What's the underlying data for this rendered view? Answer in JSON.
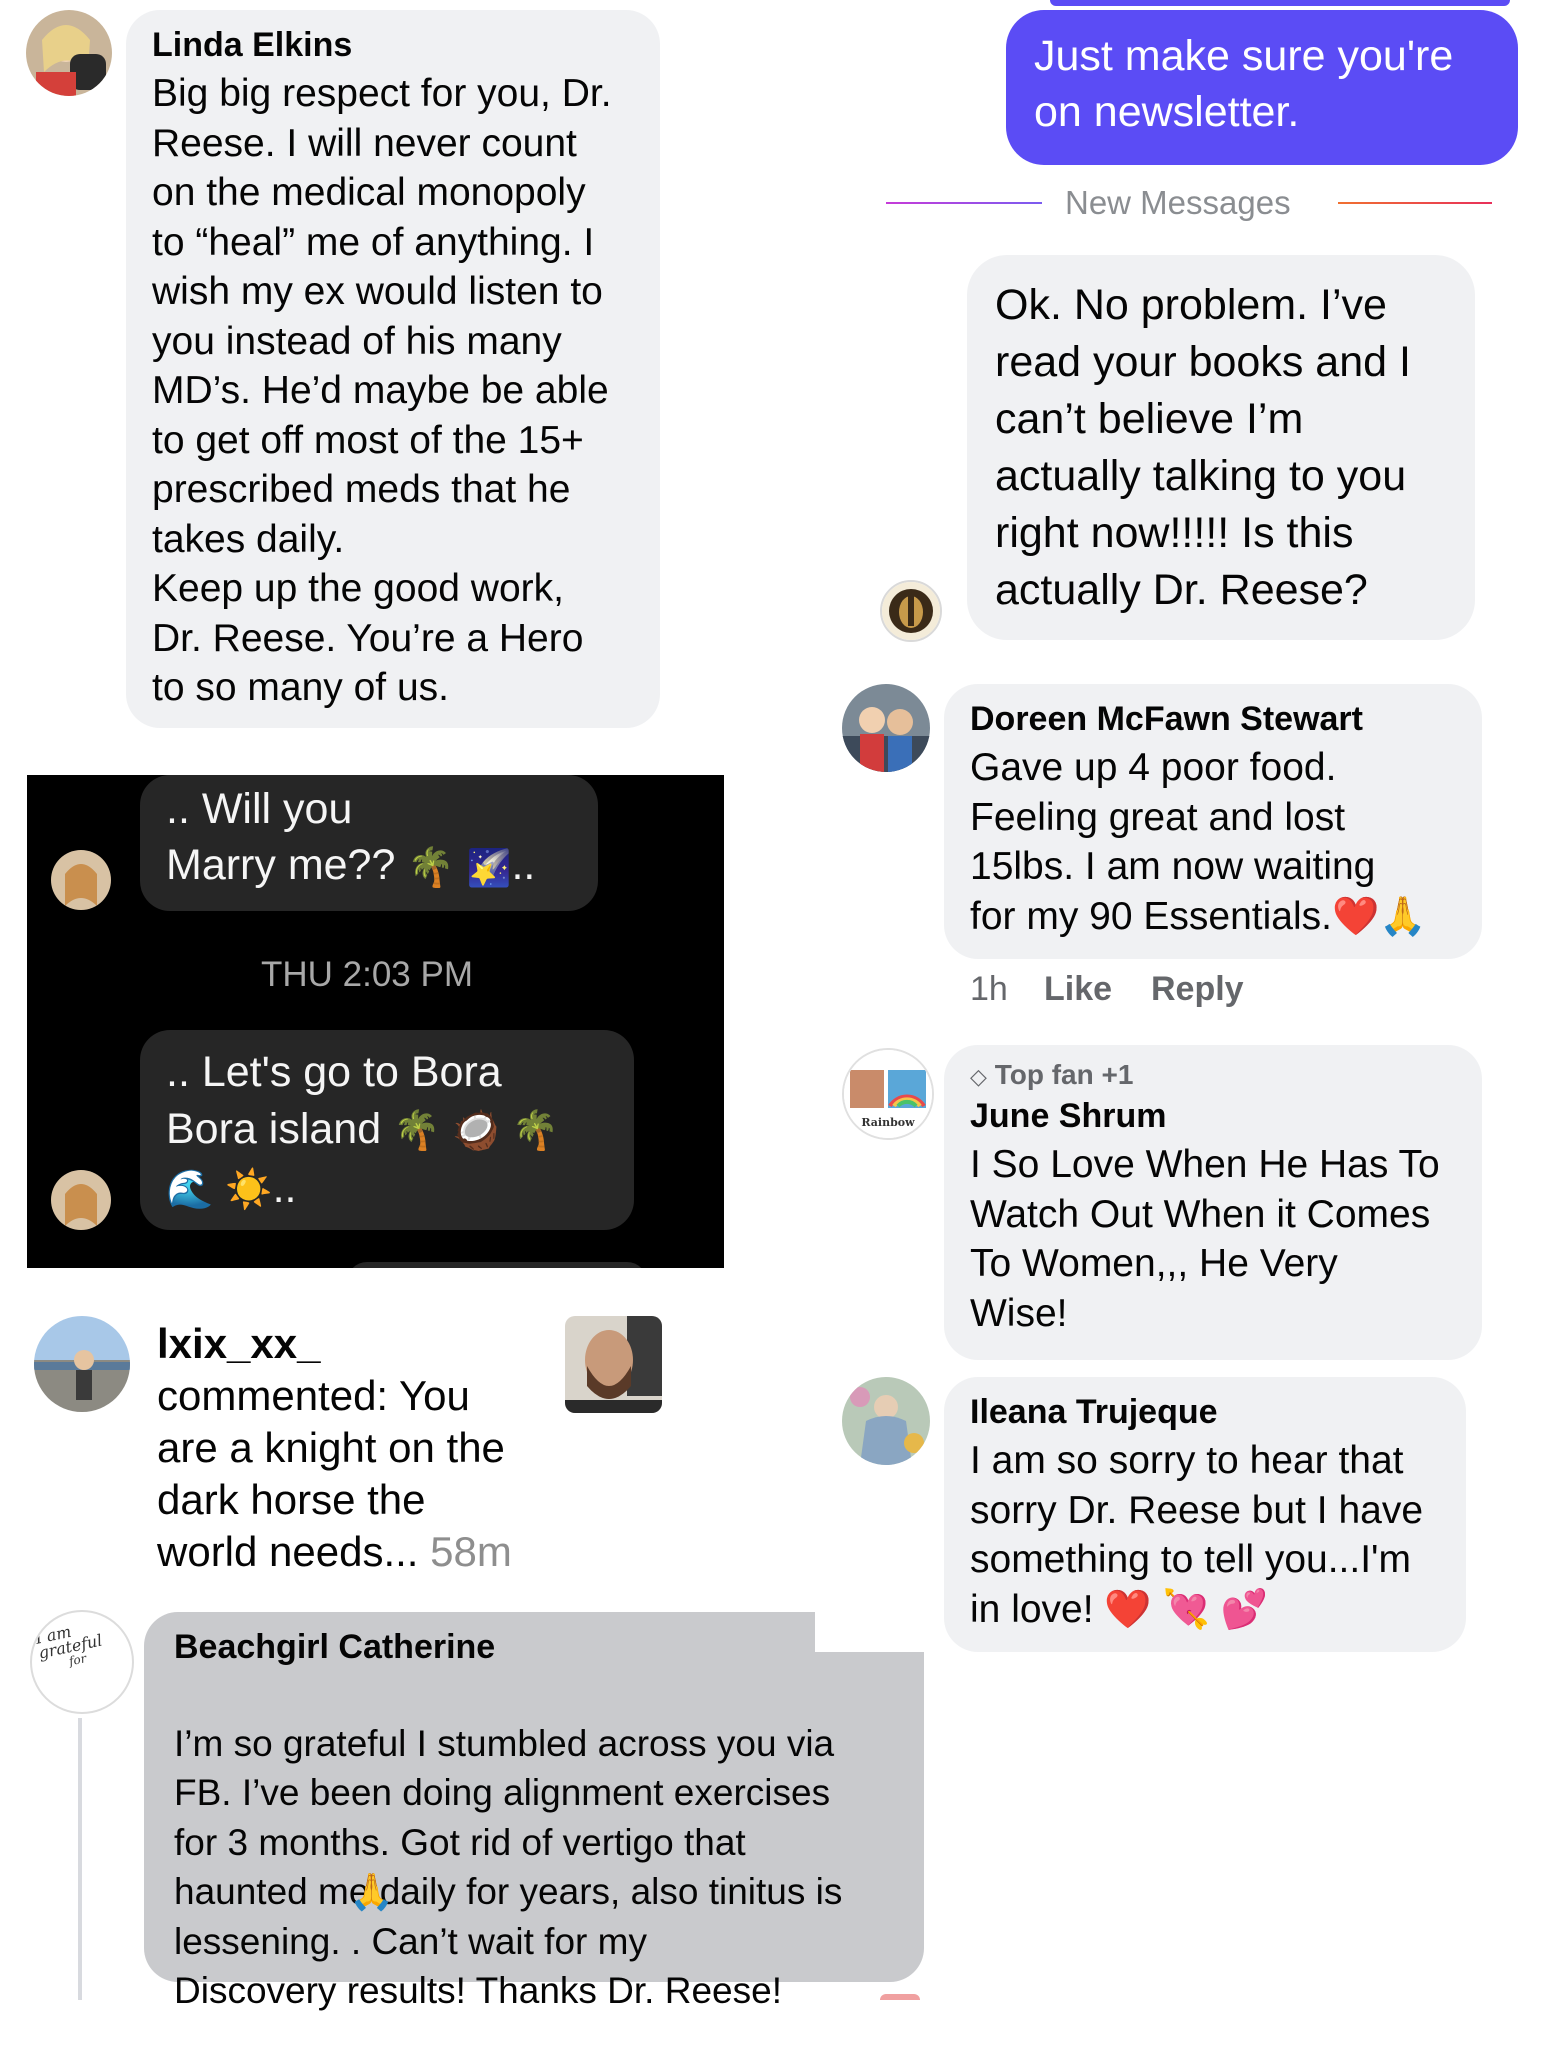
{
  "linda": {
    "name": "Linda Elkins",
    "text": "Big big respect for you, Dr.\nReese.   I will never count\non the medical monopoly\nto “heal” me of anything.  I\nwish my ex would listen to\nyou instead of his many\nMD’s.  He’d maybe be able\nto get off most of the 15+\nprescribed meds that he\ntakes daily.\nKeep up the good work,\nDr. Reese.  You’re a Hero\nto so many of us."
  },
  "newsletter": {
    "text": "Just make sure you're\non newsletter.",
    "color": "#5b4cf5"
  },
  "divider": {
    "label": "New Messages"
  },
  "ok_message": {
    "text": "Ok. No problem. I’ve\nread your books and I\ncan’t believe I’m\nactually talking to you\nright now!!!!! Is this\nactually Dr. Reese?"
  },
  "dm_screenshot": {
    "msg1_line1": ".. Will you",
    "msg1_line2": "Marry me??",
    "msg1_end": "..",
    "timestamp": "THU 2:03 PM",
    "msg2_line1": ".. Let's go to Bora",
    "msg2_line2": "Bora island",
    "msg2_end": ".."
  },
  "doreen": {
    "name": "Doreen McFawn Stewart",
    "text": "Gave up 4 poor food.\nFeeling great and lost\n15lbs.  I am now waiting\nfor my 90 Essentials.",
    "time": "1h",
    "like": "Like",
    "reply": "Reply"
  },
  "june": {
    "badge": "Top fan +1",
    "name": "June Shrum",
    "text": "I So Love When He Has To\nWatch Out When it Comes\nTo Women,,, He Very\nWise!",
    "avatar_text": "Rainbow"
  },
  "lxix": {
    "user": "lxix_xx_",
    "text": "commented: You\nare a knight on the\ndark horse the\nworld needs...",
    "time": "58m"
  },
  "ileana": {
    "name": "Ileana Trujeque",
    "text": "I am so sorry to hear that\nsorry Dr. Reese but I have\nsomething to tell you...I'm\nin love!"
  },
  "catherine": {
    "name": "Beachgirl Catherine",
    "text": "I’m so grateful I stumbled across you via\nFB. I’ve been doing alignment exercises\nfor 3 months. Got rid of vertigo that\nhaunted me daily for years, also tinitus is\nlessening.   . Can’t wait for my\nDiscovery results! Thanks Dr. Reese!",
    "avatar_line1": "I am",
    "avatar_line2": "grateful",
    "avatar_line3": "for"
  }
}
